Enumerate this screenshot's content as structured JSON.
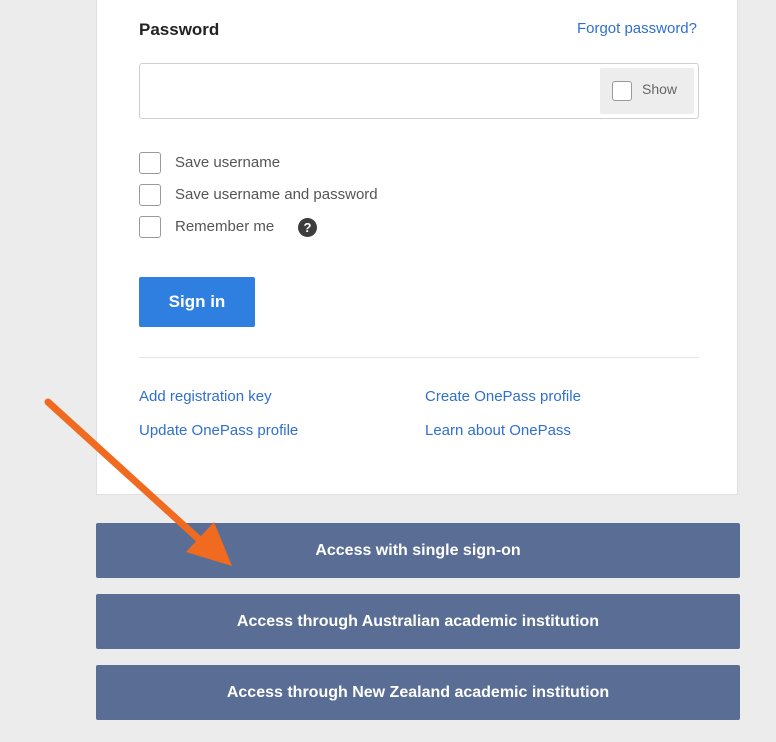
{
  "password": {
    "label": "Password",
    "forgot_link": "Forgot password?",
    "value": "",
    "show_label": "Show"
  },
  "options": [
    {
      "label": "Save username",
      "checked": false
    },
    {
      "label": "Save username and password",
      "checked": false
    },
    {
      "label": "Remember me",
      "checked": false,
      "help_icon": "?"
    }
  ],
  "signin_label": "Sign in",
  "links": {
    "add_registration_key": "Add registration key",
    "update_profile": "Update OnePass profile",
    "create_profile": "Create OnePass profile",
    "learn_about": "Learn about OnePass"
  },
  "access_buttons": [
    "Access with single sign-on",
    "Access through Australian academic institution",
    "Access through New Zealand academic institution"
  ],
  "colors": {
    "primary": "#2f7fe0",
    "link": "#2f6fd1",
    "access_button": "#5a6e95",
    "annotation_arrow": "#f06a1f"
  }
}
